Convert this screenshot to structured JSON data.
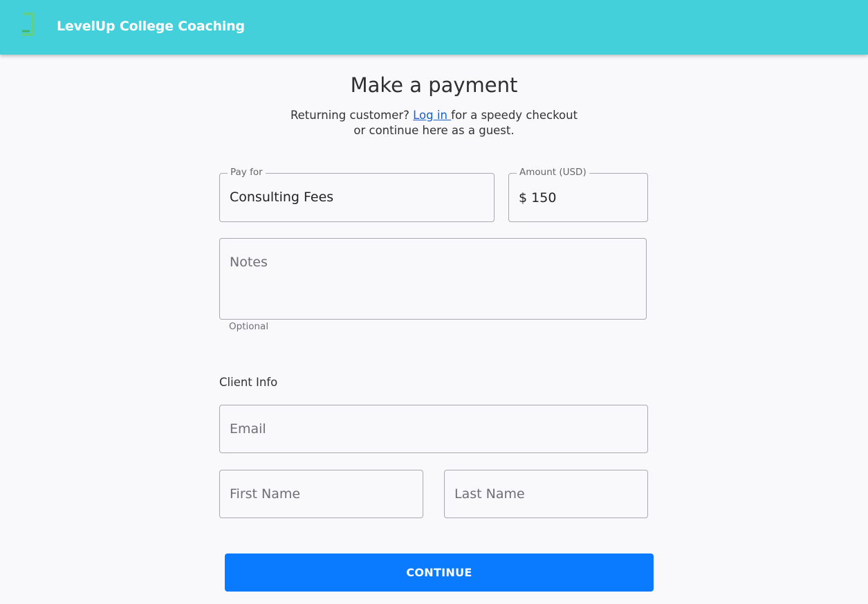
{
  "header": {
    "brand": "LevelUp College Coaching",
    "logo_icon": "bracket-logo-icon",
    "bg_color": "#43d0db"
  },
  "page": {
    "title": "Make a payment",
    "subtitle_prefix": "Returning customer? ",
    "login_link": "Log in ",
    "subtitle_suffix": "for a speedy checkout",
    "subtitle_line2": "or continue here as a guest."
  },
  "form": {
    "pay_for": {
      "label": "Pay for",
      "value": "Consulting Fees"
    },
    "amount": {
      "label": "Amount (USD)",
      "currency": "$",
      "value": "150"
    },
    "notes": {
      "placeholder": "Notes",
      "helper": "Optional"
    },
    "client_info_label": "Client Info",
    "email": {
      "placeholder": "Email"
    },
    "first_name": {
      "placeholder": "First Name"
    },
    "last_name": {
      "placeholder": "Last Name"
    },
    "continue_label": "CONTINUE",
    "button_color": "#0a7aff"
  }
}
